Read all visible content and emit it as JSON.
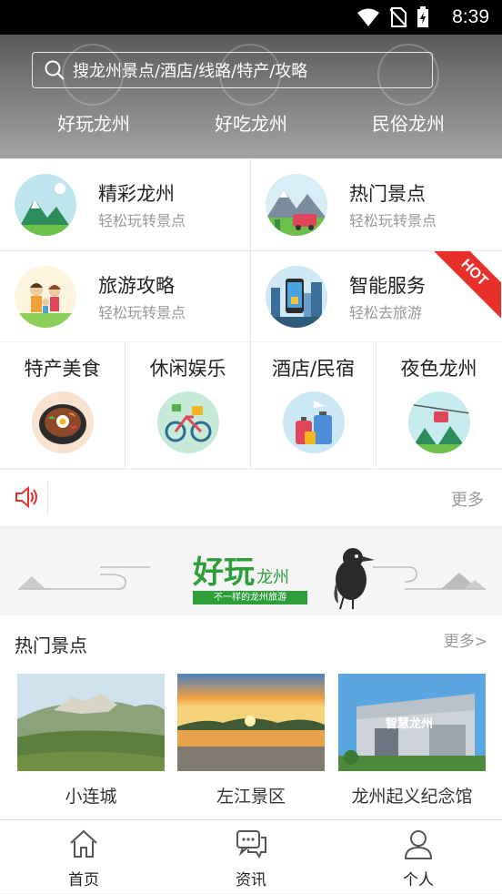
{
  "status_bar": {
    "time": "8:39"
  },
  "search": {
    "placeholder": "搜龙州景点/酒店/线路/特产/攻略"
  },
  "header_categories": [
    {
      "label": "好玩龙州"
    },
    {
      "label": "好吃龙州"
    },
    {
      "label": "民俗龙州"
    }
  ],
  "main_grid": [
    {
      "title": "精彩龙州",
      "subtitle": "轻松玩转景点"
    },
    {
      "title": "热门景点",
      "subtitle": "轻松玩转景点"
    },
    {
      "title": "旅游攻略",
      "subtitle": "轻松玩转景点"
    },
    {
      "title": "智能服务",
      "subtitle": "轻松去旅游",
      "badge": "HOT"
    }
  ],
  "quick_grid": [
    {
      "title": "特产美食"
    },
    {
      "title": "休闲娱乐"
    },
    {
      "title": "酒店/民宿"
    },
    {
      "title": "夜色龙州"
    }
  ],
  "notice": {
    "more_label": "更多"
  },
  "banner": {
    "title": "好玩",
    "title_suffix": "龙州",
    "tagline": "不一样的龙州旅游"
  },
  "hot_spots": {
    "title": "热门景点",
    "more_label": "更多>",
    "items": [
      {
        "name": "小连城"
      },
      {
        "name": "左江景区"
      },
      {
        "name": "龙州起义纪念馆",
        "photo_caption": "智慧龙州"
      }
    ]
  },
  "tab_bar": {
    "tabs": [
      {
        "label": "首页"
      },
      {
        "label": "资讯"
      },
      {
        "label": "个人"
      }
    ]
  },
  "colors": {
    "accent_red": "#e8302a",
    "banner_green": "#2e9e3a"
  }
}
